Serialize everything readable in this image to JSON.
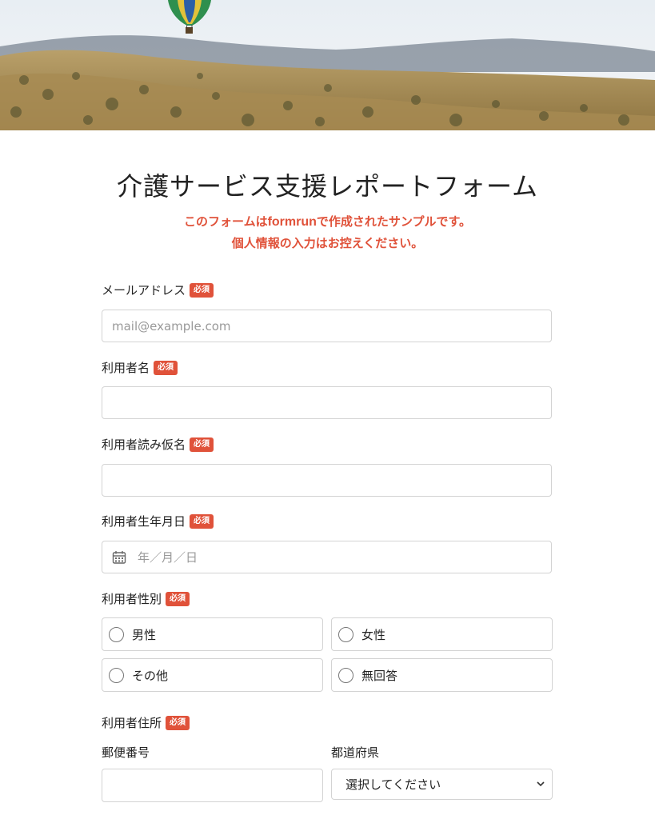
{
  "header": {
    "title": "介護サービス支援レポートフォーム",
    "notice_prefix": "このフォームは",
    "notice_brand": "formrun",
    "notice_suffix": "で作成されたサンプルです。",
    "notice_line2": "個人情報の入力はお控えください。"
  },
  "required_badge": "必須",
  "fields": {
    "email": {
      "label": "メールアドレス",
      "placeholder": "mail@example.com",
      "value": ""
    },
    "name": {
      "label": "利用者名",
      "value": ""
    },
    "kana": {
      "label": "利用者読み仮名",
      "value": ""
    },
    "birthdate": {
      "label": "利用者生年月日",
      "placeholder": "年／月／日"
    },
    "gender": {
      "label": "利用者性別",
      "options": [
        "男性",
        "女性",
        "その他",
        "無回答"
      ]
    },
    "address": {
      "label": "利用者住所",
      "postal_label": "郵便番号",
      "prefecture_label": "都道府県",
      "prefecture_selected": "選択してください"
    }
  },
  "colors": {
    "accent": "#e0523a",
    "border": "#d3d3d3",
    "text": "#222222"
  }
}
